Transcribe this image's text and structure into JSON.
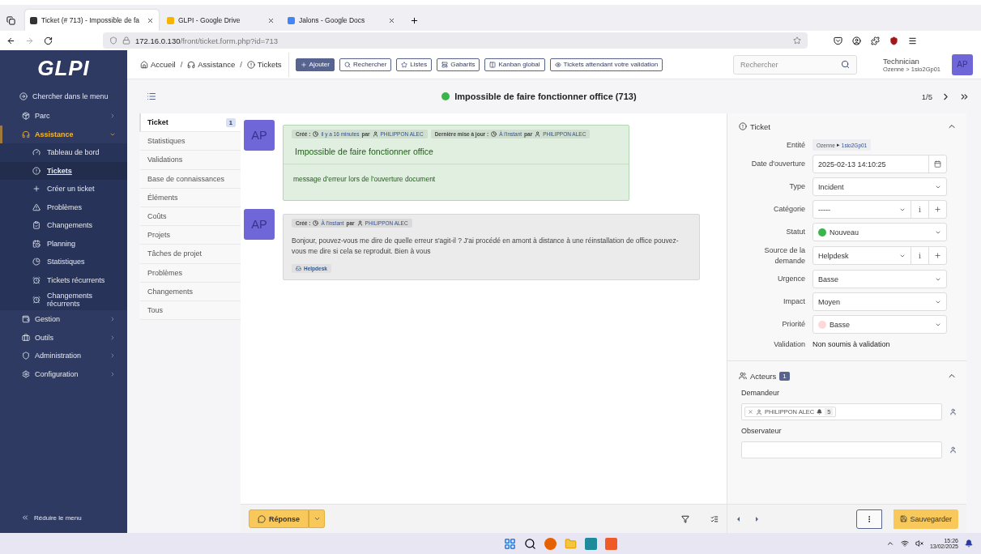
{
  "browser": {
    "tabs": [
      {
        "title": "Ticket (# 713) - Impossible de fa",
        "selected": true
      },
      {
        "title": "GLPI - Google Drive",
        "selected": false
      },
      {
        "title": "Jalons - Google Docs",
        "selected": false
      }
    ],
    "url_host": "172.16.0.130",
    "url_path": "/front/ticket.form.php?id=713"
  },
  "sidebar": {
    "logo": "GLPI",
    "search": "Chercher dans le menu",
    "items": [
      {
        "label": "Parc",
        "selected": false,
        "expanded": false
      },
      {
        "label": "Assistance",
        "selected": true,
        "expanded": true,
        "children": [
          {
            "label": "Tableau de bord",
            "selected": false
          },
          {
            "label": "Tickets",
            "selected": true
          },
          {
            "label": "Créer un ticket",
            "selected": false
          },
          {
            "label": "Problèmes",
            "selected": false
          },
          {
            "label": "Changements",
            "selected": false
          },
          {
            "label": "Planning",
            "selected": false
          },
          {
            "label": "Statistiques",
            "selected": false
          },
          {
            "label": "Tickets récurrents",
            "selected": false
          },
          {
            "label": "Changements récurrents",
            "selected": false
          }
        ]
      },
      {
        "label": "Gestion",
        "selected": false,
        "expanded": false
      },
      {
        "label": "Outils",
        "selected": false,
        "expanded": false
      },
      {
        "label": "Administration",
        "selected": false,
        "expanded": false
      },
      {
        "label": "Configuration",
        "selected": false,
        "expanded": false
      }
    ],
    "collapse": "Réduire le menu"
  },
  "header": {
    "breadcrumbs": [
      "Accueil",
      "Assistance",
      "Tickets"
    ],
    "separator": "/",
    "buttons": [
      {
        "label": "Ajouter",
        "kind": "primary"
      },
      {
        "label": "Rechercher",
        "kind": "outline"
      },
      {
        "label": "Listes",
        "kind": "outline"
      },
      {
        "label": "Gabarits",
        "kind": "outline"
      },
      {
        "label": "Kanban global",
        "kind": "outline"
      },
      {
        "label": "Tickets attendant votre validation",
        "kind": "outline"
      }
    ],
    "search": {
      "placeholder": "Rechercher"
    },
    "user": {
      "name": "Technician",
      "entity": "Ozenne > 1sio2Gp01",
      "initials": "AP"
    }
  },
  "ticket": {
    "title": "Impossible de faire fonctionner office (713)",
    "color": "#3bb54a",
    "pager": "1/5"
  },
  "tabs": [
    {
      "label": "Ticket",
      "selected": true,
      "count": "1"
    },
    {
      "label": "Statistiques",
      "selected": false
    },
    {
      "label": "Validations",
      "selected": false
    },
    {
      "label": "Base de connaissances",
      "selected": false
    },
    {
      "label": "Éléments",
      "selected": false
    },
    {
      "label": "Coûts",
      "selected": false
    },
    {
      "label": "Projets",
      "selected": false
    },
    {
      "label": "Tâches de projet",
      "selected": false
    },
    {
      "label": "Problèmes",
      "selected": false
    },
    {
      "label": "Changements",
      "selected": false
    },
    {
      "label": "Tous",
      "selected": false
    }
  ],
  "timeline": [
    {
      "kind": "ticket",
      "initials": "AP",
      "meta": [
        {
          "label": "Créé :",
          "time": "il y a 16 minutes",
          "by": "par",
          "user": "PHILIPPON ALEC"
        },
        {
          "label": "Dernière mise à jour :",
          "time": "À l'instant",
          "by": "par",
          "user": "PHILIPPON ALEC"
        }
      ],
      "title": "Impossible de faire fonctionner office",
      "body": "message d'erreur lors de l'ouverture document"
    },
    {
      "kind": "followup",
      "initials": "AP",
      "meta": [
        {
          "label": "Créé :",
          "time": "À l'instant",
          "by": "par",
          "user": "PHILIPPON ALEC"
        }
      ],
      "body": "Bonjour, pouvez-vous me dire de quelle erreur s'agit-il ? J'ai procédé en amont à distance à une réinstallation de office pouvez-vous me dire si cela se reproduit. Bien à vous",
      "source": "Helpdesk"
    }
  ],
  "reply_button": "Réponse",
  "panel": {
    "title": "Ticket",
    "fields": [
      {
        "label": "Entité",
        "kind": "entity",
        "value": "Ozenne",
        "separator": "▸",
        "value2": "1sio2Gp01"
      },
      {
        "label": "Date d'ouverture",
        "kind": "date",
        "value": "2025-02-13 14:10:25"
      },
      {
        "label": "Type",
        "kind": "select",
        "value": "Incident"
      },
      {
        "label": "Catégorie",
        "kind": "select-actions",
        "value": "-----",
        "info": "i"
      },
      {
        "label": "Statut",
        "kind": "select",
        "value": "Nouveau",
        "color": "#3bb54a"
      },
      {
        "label": "Source de la demande",
        "kind": "select-actions",
        "value": "Helpdesk",
        "info": "i"
      },
      {
        "label": "Urgence",
        "kind": "select",
        "value": "Basse"
      },
      {
        "label": "Impact",
        "kind": "select",
        "value": "Moyen"
      },
      {
        "label": "Priorité",
        "kind": "select",
        "value": "Basse",
        "color": "#ffd9d9"
      },
      {
        "label": "Validation",
        "kind": "text",
        "value": "Non soumis à validation"
      }
    ],
    "actors": {
      "title": "Acteurs",
      "count": "1",
      "groups": [
        {
          "label": "Demandeur",
          "entries": [
            {
              "name": "PHILIPPON ALEC",
              "count": "5"
            }
          ]
        },
        {
          "label": "Observateur"
        }
      ]
    },
    "save": "Sauvegarder"
  },
  "taskbar": {
    "time": "15:26",
    "date": "13/02/2025"
  }
}
